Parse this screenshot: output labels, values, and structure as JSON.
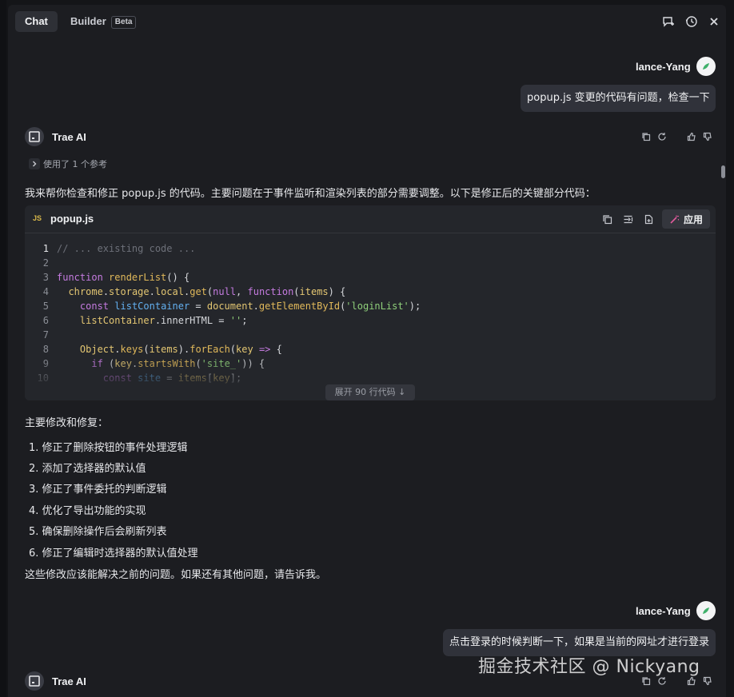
{
  "tabs": [
    {
      "label": "Chat",
      "active": true
    },
    {
      "label": "Builder",
      "badge": "Beta",
      "active": false
    }
  ],
  "toolbar_icons": [
    "new-chat-icon",
    "history-icon",
    "close-icon"
  ],
  "messages": {
    "user1": {
      "name": "lance-Yang",
      "text": "popup.js  变更的代码有问题，检查一下"
    },
    "ai1": {
      "name": "Trae AI",
      "reference": "使用了 1 个参考",
      "intro": "我来帮你检查和修正 popup.js 的代码。主要问题在于事件监听和渲染列表的部分需要调整。以下是修正后的关键部分代码：",
      "code": {
        "file_badge": "JS",
        "filename": "popup.js",
        "apply_label": "应用",
        "expand_label": "展开 90 行代码 ↓",
        "line_numbers": [
          "1",
          "2",
          "3",
          "4",
          "5",
          "6",
          "7",
          "8",
          "9",
          "10"
        ]
      },
      "summary_title": "主要修改和修复：",
      "fixes": [
        "1. 修正了删除按钮的事件处理逻辑",
        "2. 添加了选择器的默认值",
        "3. 修正了事件委托的判断逻辑",
        "4. 优化了导出功能的实现",
        "5. 确保删除操作后会刷新列表",
        "6. 修正了编辑时选择器的默认值处理"
      ],
      "closing": "这些修改应该能解决之前的问题。如果还有其他问题，请告诉我。"
    },
    "user2": {
      "name": "lance-Yang",
      "text": "点击登录的时候判断一下，如果是当前的网址才进行登录"
    },
    "ai2": {
      "name": "Trae AI"
    }
  },
  "watermark": "掘金技术社区 @ Nickyang",
  "colors": {
    "background": "#1c1d21",
    "bubble": "#30323a",
    "code_bg": "#24262b",
    "keyword": "#c57be0",
    "function": "#e0b85a",
    "variable": "#63b0f0",
    "string": "#8fcf7a"
  }
}
